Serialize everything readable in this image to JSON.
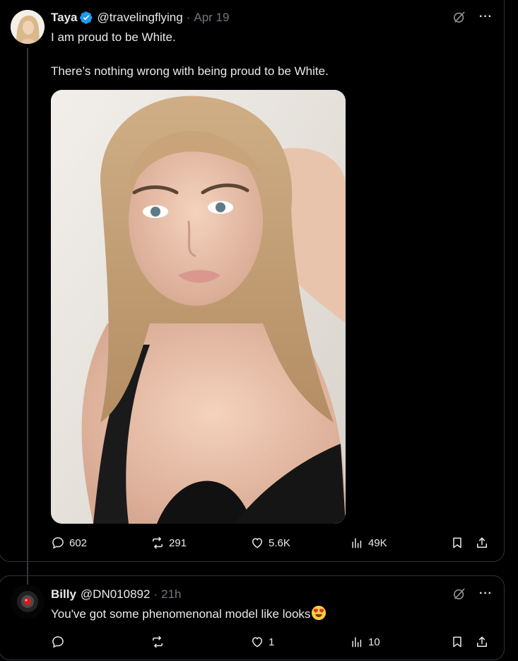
{
  "tweet": {
    "author_name": "Taya",
    "handle": "@travelingflying",
    "separator": "·",
    "time": "Apr 19",
    "line1": "I am proud to be White.",
    "line2": "There’s nothing wrong with being proud to be White.",
    "more": "···",
    "stats": {
      "replies": "602",
      "reposts": "291",
      "likes": "5.6K",
      "views": "49K"
    }
  },
  "reply": {
    "author_name": "Billy",
    "handle": "@DN010892",
    "separator": "·",
    "time": "21h",
    "text": "You've got some phenomenonal model like looks",
    "more": "···",
    "stats": {
      "replies": "",
      "reposts": "",
      "likes": "1",
      "views": "10"
    }
  },
  "colors": {
    "background": "#000000",
    "text": "#e7e9ea",
    "muted": "#71767b",
    "verified": "#1d9bf0",
    "border": "#2f3336"
  },
  "icons": [
    "verified-badge-icon",
    "grok-icon",
    "more-icon",
    "reply-icon",
    "repost-icon",
    "like-icon",
    "views-icon",
    "bookmark-icon",
    "share-icon",
    "heart-eyes-emoji"
  ]
}
